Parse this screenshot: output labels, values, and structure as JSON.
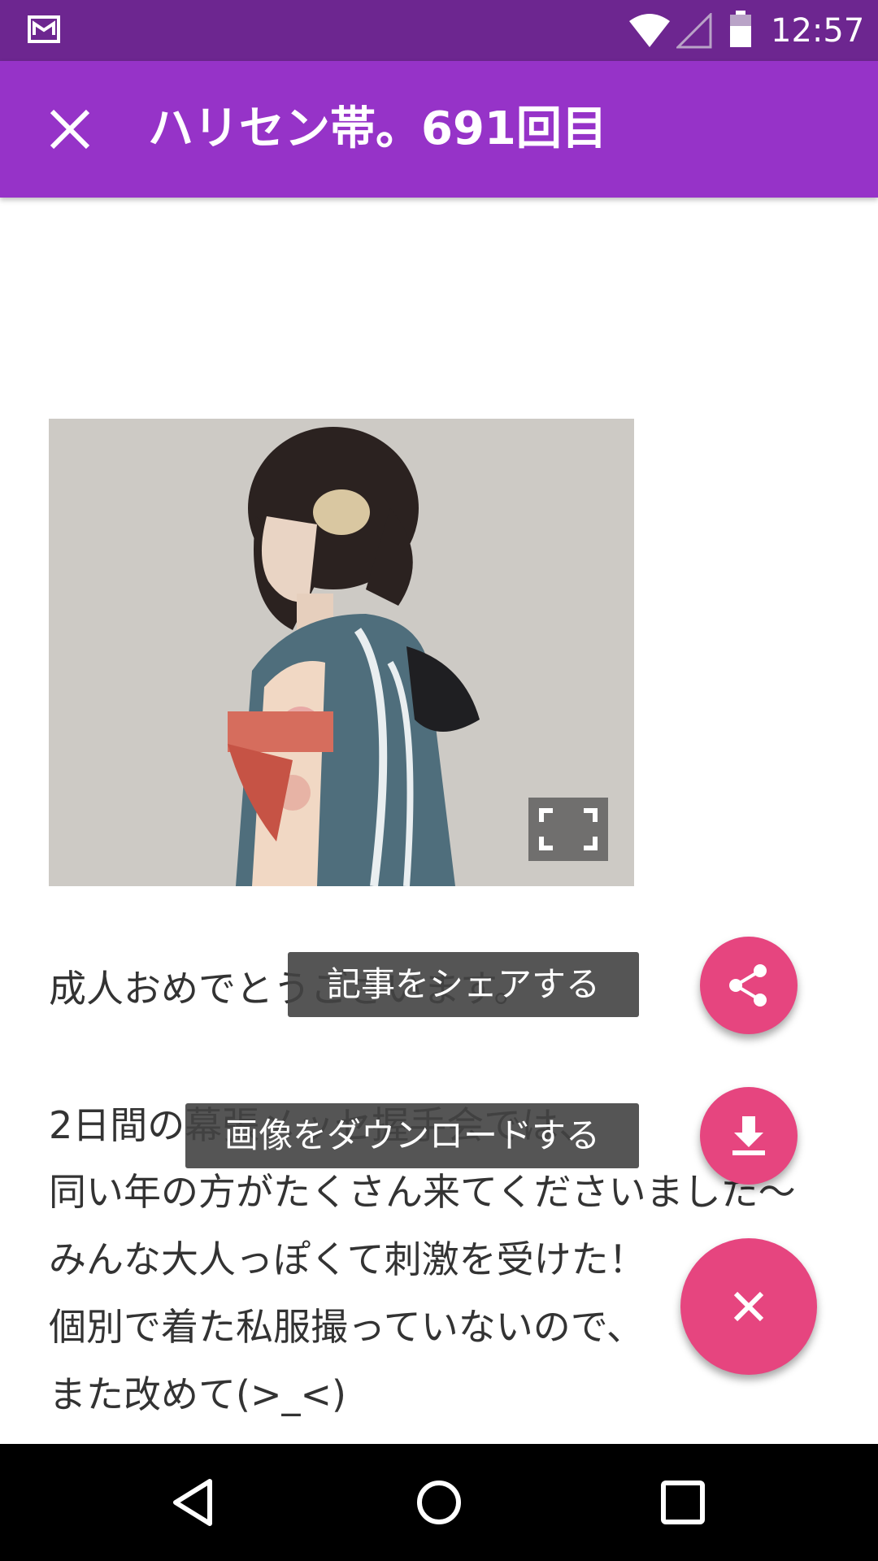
{
  "status_bar": {
    "time": "12:57",
    "icons": [
      "mail-notification-icon",
      "wifi-icon",
      "cellular-signal-icon",
      "battery-icon"
    ]
  },
  "app_bar": {
    "title": "ハリセン帯。691回目",
    "close_icon": "close-icon",
    "background": "#9633c8"
  },
  "article": {
    "image_action_icon": "fullscreen-icon",
    "paragraphs": [
      "成人おめでとうございます。",
      "2日間の幕張メッセ握手会では、",
      "同い年の方がたくさん来てくださいました〜",
      "みんな大人っぽくて刺激を受けた！",
      "個別で着た私服撮っていないので、",
      "また改めて(>_<)"
    ]
  },
  "fab_menu": {
    "share_tooltip": "記事をシェアする",
    "download_tooltip": "画像をダウンロードする",
    "share_icon": "share-icon",
    "download_icon": "download-icon",
    "main_icon": "close-icon",
    "accent": "#e6457f"
  },
  "nav_bar": {
    "icons": [
      "back-icon",
      "home-icon",
      "recents-icon"
    ]
  }
}
